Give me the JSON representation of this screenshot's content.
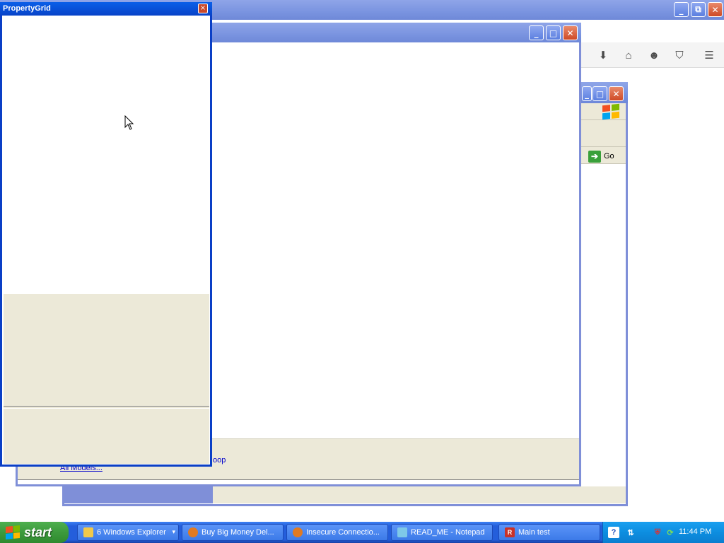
{
  "property_grid": {
    "title": "PropertyGrid",
    "close_glyph": "×"
  },
  "main_window": {
    "bottom_link_all_models": "All Models...",
    "bottom_link_partial": "oop"
  },
  "ie_window": {
    "go_label": "Go",
    "go_icon": "arrow-right-icon"
  },
  "browser_toolbar": {
    "icons": [
      "download-icon",
      "home-icon",
      "smiley-icon",
      "pocket-icon",
      "menu-icon"
    ]
  },
  "caption_glyphs": {
    "minimize": "_",
    "maximize": "□",
    "restore": "⧉",
    "close": "✕"
  },
  "taskbar": {
    "start_label": "start",
    "tasks": [
      {
        "label": "6 Windows Explorer",
        "icon": "folder-icon"
      },
      {
        "label": "Buy Big Money Del...",
        "icon": "firefox-icon"
      },
      {
        "label": "Insecure Connectio...",
        "icon": "firefox-icon"
      },
      {
        "label": "READ_ME - Notepad",
        "icon": "notepad-icon"
      },
      {
        "label": "Main test",
        "icon": "app-r-icon"
      }
    ],
    "clock": "11:44 PM",
    "tray_icons": [
      "help-icon",
      "network-icon",
      "shield-icon",
      "sync-icon"
    ]
  }
}
